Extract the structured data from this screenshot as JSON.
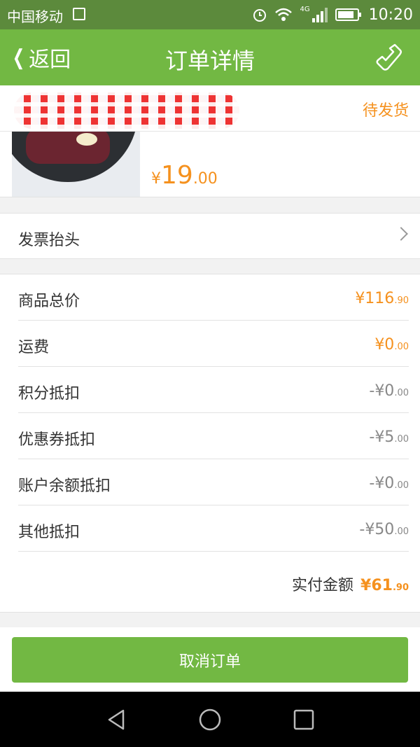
{
  "status_bar": {
    "carrier": "中国移动",
    "network": "4G",
    "time": "10:20"
  },
  "header": {
    "back_label": "返回",
    "title": "订单详情",
    "icons": {
      "back": "chevron-left-icon",
      "call": "phone-icon"
    }
  },
  "order": {
    "status": "待发货",
    "product": {
      "price_currency": "¥",
      "price_integer": "19",
      "price_decimal": ".00"
    }
  },
  "invoice": {
    "label": "发票抬头"
  },
  "summary": {
    "rows": [
      {
        "label": "商品总价",
        "value_main": "¥116",
        "value_dec": ".90",
        "tone": "orange"
      },
      {
        "label": "运费",
        "value_main": "¥0",
        "value_dec": ".00",
        "tone": "orange"
      },
      {
        "label": "积分抵扣",
        "value_main": "-¥0",
        "value_dec": ".00",
        "tone": "gray"
      },
      {
        "label": "优惠券抵扣",
        "value_main": "-¥5",
        "value_dec": ".00",
        "tone": "gray"
      },
      {
        "label": "账户余额抵扣",
        "value_main": "-¥0",
        "value_dec": ".00",
        "tone": "gray"
      },
      {
        "label": "其他抵扣",
        "value_main": "-¥50",
        "value_dec": ".00",
        "tone": "gray"
      }
    ],
    "total": {
      "label": "实付金额",
      "value_main": "¥61",
      "value_dec": ".90"
    }
  },
  "footer": {
    "cancel_label": "取消订单"
  },
  "colors": {
    "brand_green": "#72b843",
    "status_green": "#5c8a3c",
    "accent_orange": "#f5911e"
  }
}
